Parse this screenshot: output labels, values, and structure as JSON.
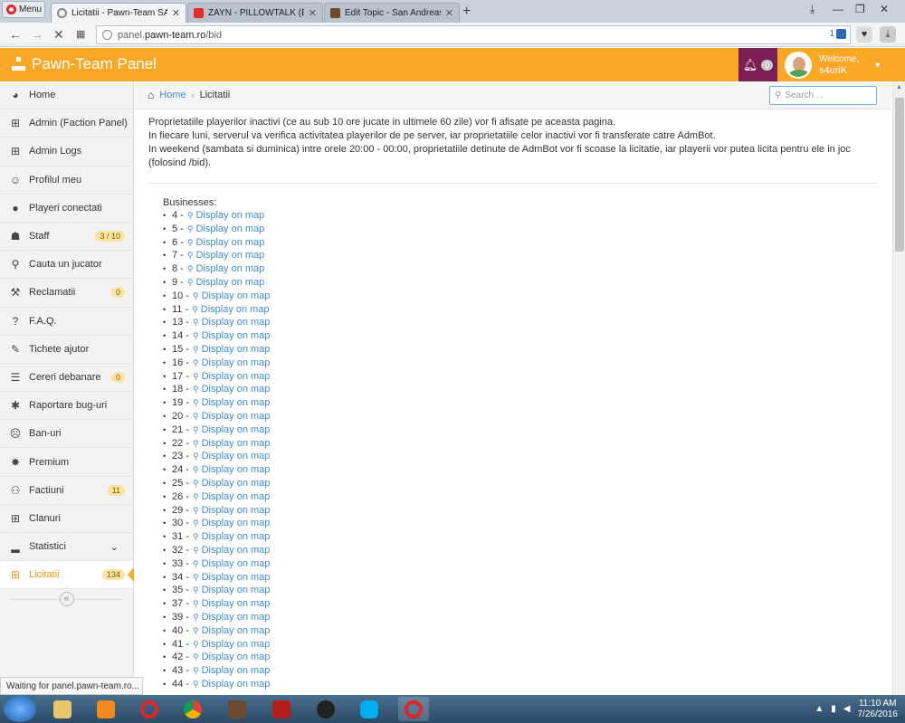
{
  "browser": {
    "menu_label": "Menu",
    "tabs": [
      {
        "title": "Licitatii - Pawn-Team SA:M",
        "active": true
      },
      {
        "title": "ZAYN - PILLOWTALK (Bea",
        "active": false
      },
      {
        "title": "Edit Topic - San Andreas M",
        "active": false
      }
    ],
    "new_tab": "+",
    "url_prefix": "panel.",
    "url_host": "pawn-team.ro",
    "url_path": "/bid",
    "url_badge_count": "1",
    "status_text": "Waiting for panel.pawn-team.ro..."
  },
  "header": {
    "brand": "Pawn-Team Panel",
    "notif_count": "0",
    "welcome": "Welcome,",
    "username": "s4uriK"
  },
  "sidebar": {
    "items": [
      {
        "label": "Home",
        "icon": "dashboard-icon",
        "glyph": "◕",
        "badge": ""
      },
      {
        "label": "Admin (Faction Panel)",
        "icon": "sitemap-icon",
        "glyph": "⊞",
        "badge": ""
      },
      {
        "label": "Admin Logs",
        "icon": "sitemap-icon",
        "glyph": "⊞",
        "badge": ""
      },
      {
        "label": "Profilul meu",
        "icon": "smile-icon",
        "glyph": "☺",
        "badge": ""
      },
      {
        "label": "Playeri conectati",
        "icon": "user-icon",
        "glyph": "●",
        "badge": ""
      },
      {
        "label": "Staff",
        "icon": "android-icon",
        "glyph": "☗",
        "badge": "3 / 10"
      },
      {
        "label": "Cauta un jucator",
        "icon": "search-icon",
        "glyph": "⚲",
        "badge": ""
      },
      {
        "label": "Reclamatii",
        "icon": "gavel-icon",
        "glyph": "⚒",
        "badge": "0"
      },
      {
        "label": "F.A.Q.",
        "icon": "question-icon",
        "glyph": "?",
        "badge": ""
      },
      {
        "label": "Tichete ajutor",
        "icon": "ticket-icon",
        "glyph": "✎",
        "badge": ""
      },
      {
        "label": "Cereri debanare",
        "icon": "list-icon",
        "glyph": "☰",
        "badge": "0"
      },
      {
        "label": "Raportare bug-uri",
        "icon": "bug-icon",
        "glyph": "✱",
        "badge": ""
      },
      {
        "label": "Ban-uri",
        "icon": "frown-icon",
        "glyph": "☹",
        "badge": ""
      },
      {
        "label": "Premium",
        "icon": "certificate-icon",
        "glyph": "✸",
        "badge": ""
      },
      {
        "label": "Factiuni",
        "icon": "users-icon",
        "glyph": "⚇",
        "badge": "11"
      },
      {
        "label": "Clanuri",
        "icon": "sitemap-icon",
        "glyph": "⊞",
        "badge": ""
      },
      {
        "label": "Statistici",
        "icon": "signal-icon",
        "glyph": "▂",
        "badge": "",
        "chevron": "⌄"
      },
      {
        "label": "Licitatii",
        "icon": "sitemap-icon",
        "glyph": "⊞",
        "badge": "134",
        "active": true
      }
    ],
    "collapse": "«"
  },
  "breadcrumb": {
    "home": "Home",
    "current": "Licitatii"
  },
  "search": {
    "placeholder": "Search ..."
  },
  "intro": {
    "line1": "Proprietatiile playerilor inactivi (ce au sub 10 ore jucate in ultimele 60 zile) vor fi afisate pe aceasta pagina.",
    "line2": "In fiecare luni, serverul va verifica activitatea playerilor de pe server, iar proprietatiile celor inactivi vor fi transferate catre AdmBot.",
    "line3": "In weekend (sambata si duminica) intre orele 20:00 - 00:00, proprietatiile detinute de AdmBot vor fi scoase la licitatie, iar playerii vor putea licita pentru ele in joc (folosind /bid)."
  },
  "businesses": {
    "title": "Businesses:",
    "link_label": "Display on map",
    "ids": [
      "4",
      "5",
      "6",
      "7",
      "8",
      "9",
      "10",
      "11",
      "13",
      "14",
      "15",
      "16",
      "17",
      "18",
      "19",
      "20",
      "21",
      "22",
      "23",
      "24",
      "25",
      "26",
      "29",
      "30",
      "31",
      "32",
      "33",
      "34",
      "35",
      "37",
      "39",
      "40",
      "41",
      "42",
      "43",
      "44"
    ]
  },
  "taskbar": {
    "time": "11:10 AM",
    "date": "7/26/2016"
  },
  "colors": {
    "accent": "#f9a825",
    "notif_bg": "#7b1f54",
    "link": "#428bca"
  }
}
